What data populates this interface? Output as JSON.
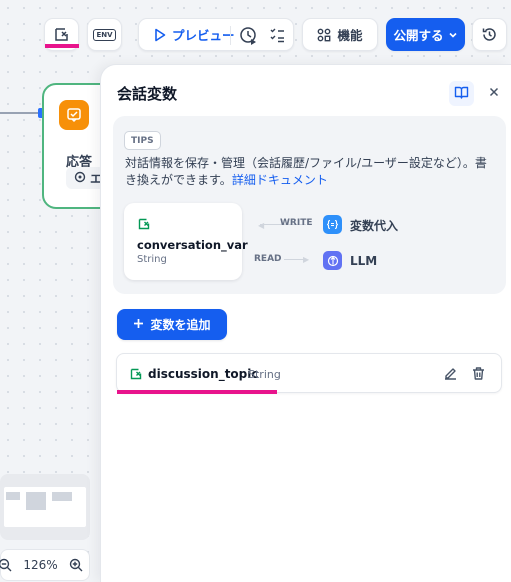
{
  "toolbar": {
    "preview_label": "プレビュー",
    "features_label": "機能",
    "publish_label": "公開する",
    "env_label": "ENV"
  },
  "canvas": {
    "node_label": "応答",
    "node_chip": "エ",
    "zoom_level": "126%"
  },
  "panel": {
    "title": "会話変数",
    "tips": {
      "badge": "TIPS",
      "text": "対話情報を保存・管理（会話履歴/ファイル/ユーザー設定など）。書き換えができます。",
      "link": "詳細ドキュメント"
    },
    "example": {
      "var_name": "conversation_var",
      "var_type": "String",
      "write_label": "WRITE",
      "read_label": "READ",
      "write_target": "変数代入",
      "read_target": "LLM"
    },
    "add_button": "変数を追加",
    "variables": [
      {
        "name": "discussion_topic",
        "type": "String"
      }
    ]
  },
  "colors": {
    "accent": "#155eef",
    "highlight": "#e8138c",
    "node_border": "#4fb57f",
    "node_icon": "#f79009"
  }
}
